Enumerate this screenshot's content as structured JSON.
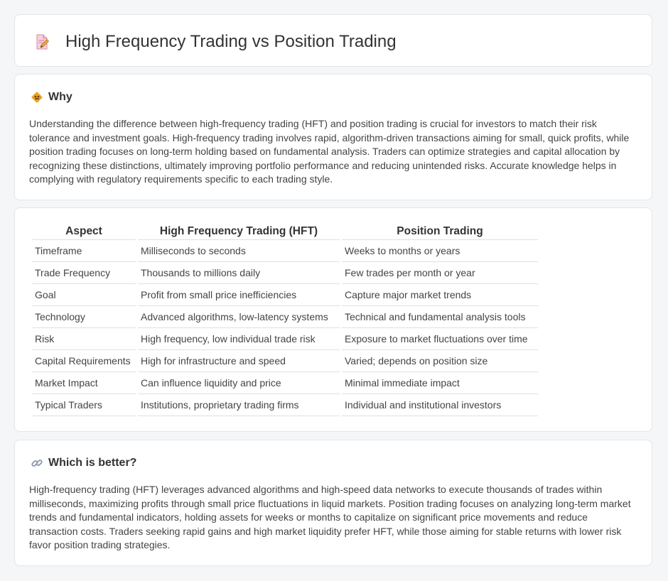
{
  "header": {
    "title": "High Frequency Trading vs Position Trading",
    "icon": "document-edit-icon"
  },
  "why": {
    "heading": "Why",
    "icon": "hazard-diamond-icon",
    "text": "Understanding the difference between high-frequency trading (HFT) and position trading is crucial for investors to match their risk tolerance and investment goals. High-frequency trading involves rapid, algorithm-driven transactions aiming for small, quick profits, while position trading focuses on long-term holding based on fundamental analysis. Traders can optimize strategies and capital allocation by recognizing these distinctions, ultimately improving portfolio performance and reducing unintended risks. Accurate knowledge helps in complying with regulatory requirements specific to each trading style."
  },
  "comparison": {
    "headers": [
      "Aspect",
      "High Frequency Trading (HFT)",
      "Position Trading"
    ],
    "rows": [
      [
        "Timeframe",
        "Milliseconds to seconds",
        "Weeks to months or years"
      ],
      [
        "Trade Frequency",
        "Thousands to millions daily",
        "Few trades per month or year"
      ],
      [
        "Goal",
        "Profit from small price inefficiencies",
        "Capture major market trends"
      ],
      [
        "Technology",
        "Advanced algorithms, low-latency systems",
        "Technical and fundamental analysis tools"
      ],
      [
        "Risk",
        "High frequency, low individual trade risk",
        "Exposure to market fluctuations over time"
      ],
      [
        "Capital Requirements",
        "High for infrastructure and speed",
        "Varied; depends on position size"
      ],
      [
        "Market Impact",
        "Can influence liquidity and price",
        "Minimal immediate impact"
      ],
      [
        "Typical Traders",
        "Institutions, proprietary trading firms",
        "Individual and institutional investors"
      ]
    ]
  },
  "better": {
    "heading": "Which is better?",
    "icon": "link-icon",
    "text": "High-frequency trading (HFT) leverages advanced algorithms and high-speed data networks to execute thousands of trades within milliseconds, maximizing profits through small price fluctuations in liquid markets. Position trading focuses on analyzing long-term market trends and fundamental indicators, holding assets for weeks or months to capitalize on significant price movements and reduce transaction costs. Traders seeking rapid gains and high market liquidity prefer HFT, while those aiming for stable returns with lower risk favor position trading strategies."
  },
  "colors": {
    "background": "#f5f6f8",
    "card": "#ffffff",
    "accent_orange": "#f0a020",
    "icon_pink": "#e8829a"
  }
}
